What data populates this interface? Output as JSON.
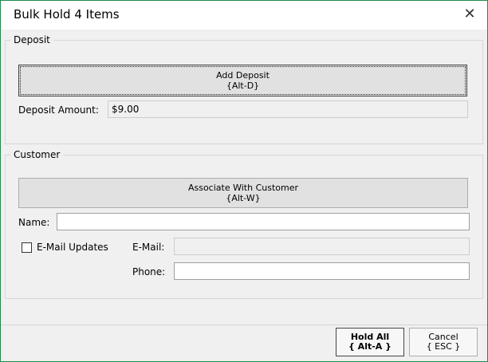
{
  "window": {
    "title": "Bulk Hold 4 Items",
    "close_glyph": "✕"
  },
  "deposit": {
    "legend": "Deposit",
    "add_button": {
      "label": "Add Deposit",
      "shortcut": "{Alt-D}"
    },
    "amount_label": "Deposit Amount:",
    "amount_value": "$9.00"
  },
  "customer": {
    "legend": "Customer",
    "associate_button": {
      "label": "Associate With Customer",
      "shortcut": "{Alt-W}"
    },
    "name_label": "Name:",
    "name_value": "",
    "email_updates_label": "E-Mail Updates",
    "email_updates_checked": false,
    "email_label": "E-Mail:",
    "email_value": "",
    "phone_label": "Phone:",
    "phone_value": ""
  },
  "footer": {
    "hold_all": {
      "label": "Hold All",
      "shortcut": "{ Alt-A }"
    },
    "cancel": {
      "label": "Cancel",
      "shortcut": "{ ESC }"
    }
  }
}
